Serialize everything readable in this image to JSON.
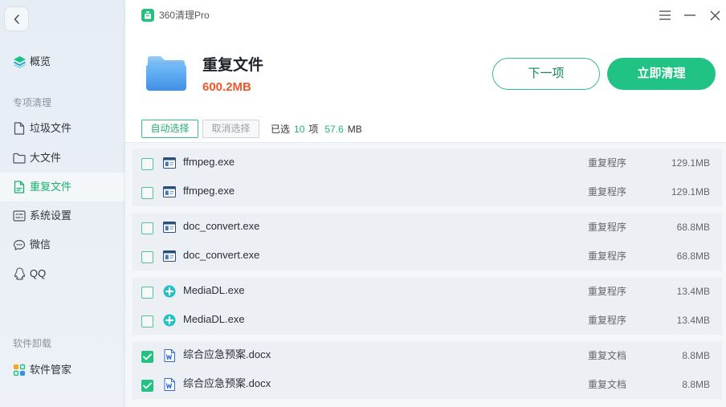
{
  "app": {
    "title": "360清理Pro",
    "logo_icon": "app-logo-icon"
  },
  "window_controls": {
    "menu_icon": "menu-icon",
    "minimize_icon": "minimize-icon",
    "close_icon": "close-icon"
  },
  "nav": {
    "back_icon": "chevron-left-icon"
  },
  "sidebar": {
    "overview": {
      "label": "概览",
      "icon": "layers-icon",
      "selected": false
    },
    "sections": [
      {
        "title": "专项清理",
        "items": [
          {
            "label": "垃圾文件",
            "icon": "file-icon",
            "selected": false
          },
          {
            "label": "大文件",
            "icon": "folder-icon",
            "selected": false
          },
          {
            "label": "重复文件",
            "icon": "duplicate-file-icon",
            "selected": true
          },
          {
            "label": "系统设置",
            "icon": "settings-icon",
            "selected": false
          },
          {
            "label": "微信",
            "icon": "wechat-icon",
            "selected": false
          },
          {
            "label": "QQ",
            "icon": "qq-icon",
            "selected": false
          }
        ]
      },
      {
        "title": "软件卸载",
        "items": [
          {
            "label": "软件管家",
            "icon": "app-grid-icon",
            "selected": false
          }
        ]
      }
    ]
  },
  "header": {
    "icon": "folder-large-icon",
    "title": "重复文件",
    "total_size": "600.2MB",
    "next_button": "下一项",
    "clean_button": "立即清理"
  },
  "toolbar": {
    "auto_select": "自动选择",
    "cancel_select": "取消选择",
    "selected_prefix": "已选",
    "selected_count": "10",
    "count_unit": "项",
    "selected_size": "57.6",
    "size_unit": "MB"
  },
  "groups": [
    {
      "rows": [
        {
          "name": "ffmpeg.exe",
          "type": "重复程序",
          "size": "129.1MB",
          "checked": false,
          "icon": "exe-icon"
        },
        {
          "name": "ffmpeg.exe",
          "type": "重复程序",
          "size": "129.1MB",
          "checked": false,
          "icon": "exe-icon"
        }
      ]
    },
    {
      "rows": [
        {
          "name": "doc_convert.exe",
          "type": "重复程序",
          "size": "68.8MB",
          "checked": false,
          "icon": "exe-icon"
        },
        {
          "name": "doc_convert.exe",
          "type": "重复程序",
          "size": "68.8MB",
          "checked": false,
          "icon": "exe-icon"
        }
      ]
    },
    {
      "rows": [
        {
          "name": "MediaDL.exe",
          "type": "重复程序",
          "size": "13.4MB",
          "checked": false,
          "icon": "mediadl-icon"
        },
        {
          "name": "MediaDL.exe",
          "type": "重复程序",
          "size": "13.4MB",
          "checked": false,
          "icon": "mediadl-icon"
        }
      ]
    },
    {
      "rows": [
        {
          "name": "综合应急预案.docx",
          "type": "重复文档",
          "size": "8.8MB",
          "checked": true,
          "icon": "word-doc-icon"
        },
        {
          "name": "综合应急预案.docx",
          "type": "重复文档",
          "size": "8.8MB",
          "checked": true,
          "icon": "word-doc-icon"
        }
      ]
    }
  ],
  "colors": {
    "accent": "#22c283",
    "size_highlight": "#f0572b",
    "sidebar_bg": "#e9eff6",
    "selected_text": "#16b26c"
  }
}
